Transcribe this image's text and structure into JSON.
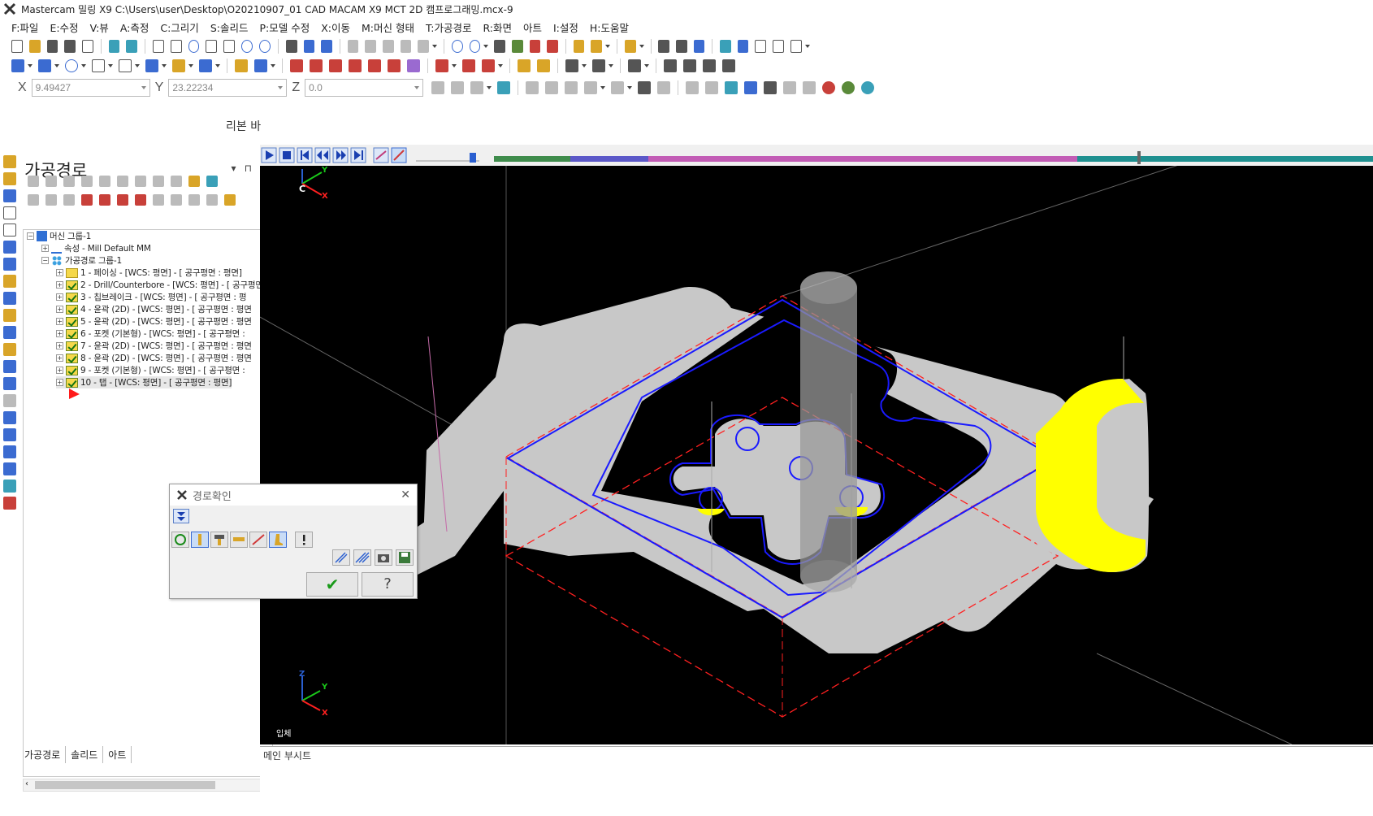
{
  "window": {
    "title": "Mastercam 밀링 X9  C:\\Users\\user\\Desktop\\O20210907_01 CAD MACAM X9 MCT 2D 캠프로그래밍.mcx-9"
  },
  "menu": [
    "F:파일",
    "E:수정",
    "V:뷰",
    "A:측정",
    "C:그리기",
    "S:솔리드",
    "P:모델 수정",
    "X:이동",
    "M:머신 형태",
    "T:가공경로",
    "R:화면",
    "아트",
    "I:설정",
    "H:도움말"
  ],
  "coords": {
    "x_label": "X",
    "x_value": "9.49427",
    "y_label": "Y",
    "y_value": "23.22234",
    "z_label": "Z",
    "z_value": "0.0"
  },
  "ribbon_label": "리본 바",
  "panel": {
    "title": "가공경로",
    "pin_glyph": "▾",
    "dock_glyph": "⊓",
    "close_glyph": "✕",
    "tree": [
      {
        "label": "머신 그룹-1",
        "icon": "machine-group-icon"
      },
      {
        "label": "속성 - Mill Default MM",
        "icon": "properties-icon"
      },
      {
        "label": "가공경로 그룹-1",
        "icon": "toolpath-group-icon"
      },
      {
        "label": "1 - 페이싱 - [WCS: 평면] - [ 공구평면 : 평면]",
        "icon": "folder-icon"
      },
      {
        "label": "2 - Drill/Counterbore - [WCS: 평면] - [ 공구평면",
        "icon": "folder-check-icon"
      },
      {
        "label": "3 - 칩브레이크 - [WCS: 평면] - [ 공구평면 : 평",
        "icon": "folder-check-icon"
      },
      {
        "label": "4 - 윤곽 (2D) - [WCS: 평면] - [ 공구평면 : 평면",
        "icon": "folder-check-icon"
      },
      {
        "label": "5 - 윤곽 (2D) - [WCS: 평면] - [ 공구평면 : 평면",
        "icon": "folder-check-icon"
      },
      {
        "label": "6 - 포켓 (기본형) - [WCS: 평면] - [ 공구평면 :",
        "icon": "folder-check-icon"
      },
      {
        "label": "7 - 윤곽 (2D) - [WCS: 평면] - [ 공구평면 : 평면",
        "icon": "folder-check-icon"
      },
      {
        "label": "8 - 윤곽 (2D) - [WCS: 평면] - [ 공구평면 : 평면",
        "icon": "folder-check-icon"
      },
      {
        "label": "9 - 포켓 (기본형) - [WCS: 평면] - [ 공구평면 :",
        "icon": "folder-check-icon"
      },
      {
        "label": "10 - 탭 - [WCS: 평면] - [ 공구평면 : 평면]",
        "icon": "folder-check-icon"
      }
    ],
    "tabs": [
      "가공경로",
      "솔리드",
      "아트"
    ]
  },
  "viewport": {
    "view_label": "입체",
    "axis_c": "C",
    "axis_x": "X",
    "axis_y": "Y",
    "axis_z": "Z",
    "bottom_tab": "메인 부시트"
  },
  "dialog": {
    "title": "경로확인",
    "close_glyph": "✕",
    "ok_glyph": "✔",
    "help_glyph": "?"
  },
  "colors": {
    "viewport_bg": "#000000",
    "stock": "#c8c8c8",
    "toolpath": "#1a1aff",
    "boundary": "#ff2020",
    "highlight": "#ffff00"
  }
}
